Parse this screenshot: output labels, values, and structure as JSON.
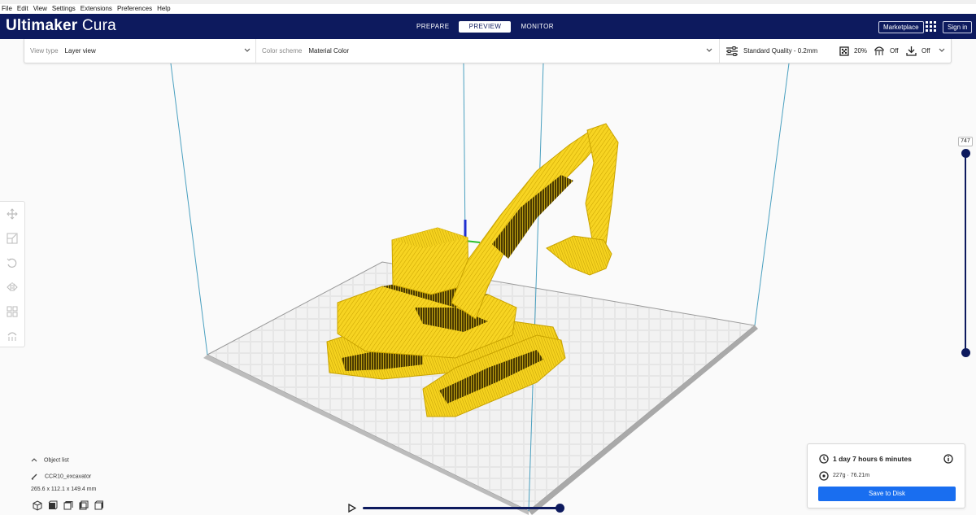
{
  "menu": [
    "File",
    "Edit",
    "View",
    "Settings",
    "Extensions",
    "Preferences",
    "Help"
  ],
  "app": {
    "brand_bold": "Ultimaker",
    "brand_light": " Cura"
  },
  "stages": [
    {
      "label": "PREPARE",
      "active": false
    },
    {
      "label": "PREVIEW",
      "active": true
    },
    {
      "label": "MONITOR",
      "active": false
    }
  ],
  "header": {
    "marketplace": "Marketplace",
    "signin": "Sign in"
  },
  "settings": {
    "view_type_label": "View type",
    "view_type_value": "Layer view",
    "color_scheme_label": "Color scheme",
    "color_scheme_value": "Material Color",
    "quality": "Standard Quality - 0.2mm",
    "infill": "20%",
    "support": "Off",
    "adhesion": "Off"
  },
  "layer": {
    "current": "747"
  },
  "object_list": {
    "title": "Object list",
    "object_name": "CCR10_excavator",
    "dimensions": "265.6 x 112.1 x 149.4 mm"
  },
  "print": {
    "time": "1 day 7 hours 6 minutes",
    "material": "227g · 76.21m",
    "save": "Save to Disk"
  },
  "colors": {
    "header": "#0d1a5e",
    "accent": "#196ef0",
    "model": "#f5d21e",
    "buildplate": "#c8c8c8"
  }
}
